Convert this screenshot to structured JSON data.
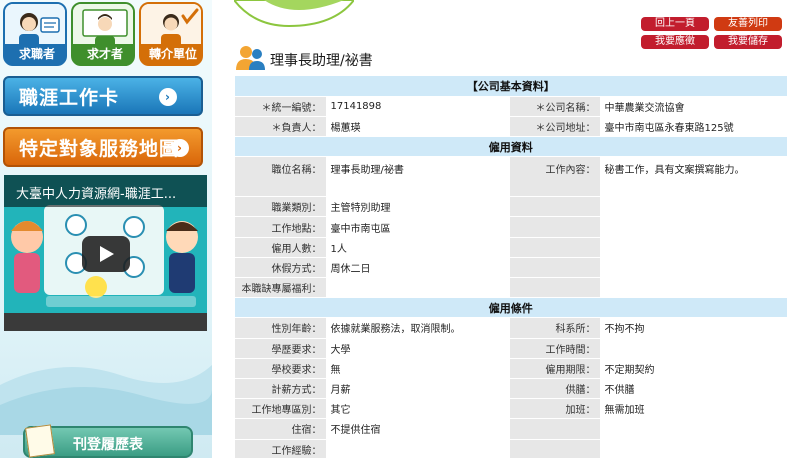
{
  "sidebar": {
    "roles": [
      {
        "label": "求職者"
      },
      {
        "label": "求才者"
      },
      {
        "label": "轉介單位"
      }
    ],
    "career_card_label": "職涯工作卡",
    "service_map_label": "特定對象服務地圖",
    "video_title": "大臺中人力資源網-職涯工...",
    "resume_label": "刊登履歷表"
  },
  "actions": {
    "back": "回上一頁",
    "print": "友善列印",
    "apply": "我要應徵",
    "save": "我要儲存"
  },
  "job_title": "理事長助理/祕書",
  "sections": {
    "company": "【公司基本資料】",
    "employment": "僱用資料",
    "conditions": "僱用條件"
  },
  "company": {
    "tax_id_label": "＊統一編號：",
    "tax_id": "17141898",
    "name_label": "＊公司名稱：",
    "name": "中華農業交流協會",
    "owner_label": "＊負責人：",
    "owner": "楊蕙瑛",
    "address_label": "＊公司地址：",
    "address": "臺中市南屯區永春東路125號"
  },
  "employment": {
    "position_label": "職位名稱：",
    "position": "理事長助理/祕書",
    "content_label": "工作內容：",
    "content": "秘書工作，具有文案撰寫能力。",
    "category_label": "職業類別：",
    "category": "主管特別助理",
    "location_label": "工作地點：",
    "location": "臺中市南屯區",
    "headcount_label": "僱用人數：",
    "headcount": "1人",
    "holiday_label": "休假方式：",
    "holiday": "周休二日",
    "welfare_label": "本職缺專屬福利："
  },
  "conditions": {
    "gender_age_label": "性別年齡：",
    "gender_age": "依據就業服務法，取消限制。",
    "department_label": "科系所：",
    "department": "不拘不拘",
    "education_label": "學歷要求：",
    "education": "大學",
    "work_hours_label": "工作時間：",
    "work_hours": "",
    "school_label": "學校要求：",
    "school": "無",
    "period_label": "僱用期限：",
    "period": "不定期契約",
    "salary_label": "計薪方式：",
    "salary": "月薪",
    "meals_label": "供膳：",
    "meals": "不供膳",
    "license_label": "工作地專區別：",
    "license": "其它",
    "overtime_label": "加班：",
    "overtime": "無需加班",
    "lodging_label": "住宿：",
    "lodging": "不提供住宿",
    "experience_label": "工作經驗：",
    "experience": ""
  },
  "colors": {
    "section_bg": "#cfe9f8",
    "label_bg": "#e7e7e7",
    "action_red": "#c21d2d"
  }
}
